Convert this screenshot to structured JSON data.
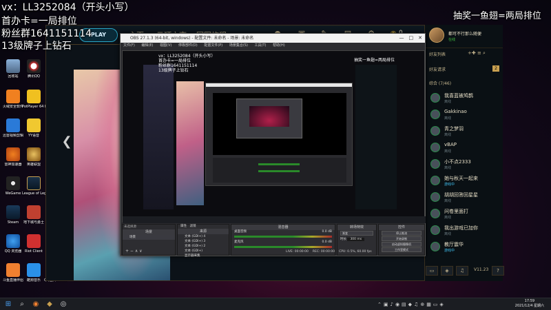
{
  "overlay": {
    "line1": "vx：LL3252084（开头小写）",
    "line2": "首办卡=一局排位",
    "line3": "粉丝群1641151114",
    "line4": "13级牌子上钻石",
    "top_right": "抽奖一鱼翅=两局排位"
  },
  "desktop_icons": [
    "回收站",
    "腾讯QQ",
    "火绒安全软件",
    "PotPlayer 64 bit",
    "迅雷视频剪辑",
    "YY语音",
    "雷神加速器",
    "英雄联盟",
    "WeGame",
    "League of Legends",
    "Steam",
    "地下城与勇士",
    "QQ 浏览器",
    "Riot Client",
    "斗鱼直播伴侣",
    "酷狗音乐",
    "QQ图片20211118..."
  ],
  "lol": {
    "play_label": "PLAY",
    "tabs": [
      "主页",
      "云顶之弈",
      "冠军旅程"
    ],
    "currency": "0",
    "friends_header": "好友列表",
    "friend_requests": "好友请求",
    "friend_requests_count": "2",
    "summoner_name": "都可不行那么随便",
    "summoner_status": "在线",
    "group_label": "综合 (7/46)",
    "friends": [
      {
        "name": "我喜蓝被鸠鹊",
        "status": "离线"
      },
      {
        "name": "Gakkinao",
        "status": "离线"
      },
      {
        "name": "青之梦羽",
        "status": "离线"
      },
      {
        "name": "vBAP",
        "status": "离线"
      },
      {
        "name": "小不点2333",
        "status": "离线"
      },
      {
        "name": "她与秋天一起来",
        "status": "游戏中"
      },
      {
        "name": "胡胡回答回星星",
        "status": "离线"
      },
      {
        "name": "问卷里面打",
        "status": "离线"
      },
      {
        "name": "我出游戏已加你",
        "status": "离线"
      },
      {
        "name": "教厅震华",
        "status": "游戏中"
      }
    ],
    "version": "V11.23"
  },
  "obs": {
    "title": "OBS 27.1.3 (64-bit, windows) - 配置文件: 未命名 - 场景: 未命名",
    "menu": [
      "文件(F)",
      "编辑(E)",
      "视图(V)",
      "停靠部件(D)",
      "配置文件(P)",
      "场景集合(S)",
      "工具(T)",
      "帮助(H)"
    ],
    "no_source": "未选择源",
    "properties": "属性",
    "filters": "滤镜",
    "docks": {
      "scenes": "场景",
      "sources": "来源",
      "mixer": "混音器",
      "transitions": "转场特效",
      "controls": "控件"
    },
    "scene_item": "场景",
    "sources": [
      "文本 (GDI+) 4",
      "文本 (GDI+) 3",
      "文本 (GDI+) 2",
      "文本 (GDI+)",
      "显示器采集"
    ],
    "mixer": [
      {
        "name": "桌面音频",
        "value": "0.0 dB"
      },
      {
        "name": "麦克风",
        "value": "0.0 dB"
      }
    ],
    "transition": "渐变",
    "duration_label": "时长",
    "duration": "300 ms",
    "controls": [
      "停止推流",
      "开始录制",
      "启动虚拟摄像机",
      "工作室模式",
      "设置",
      "退出"
    ],
    "status": {
      "live": "LIVE: 00:00:00",
      "rec": "REC: 00:00:00",
      "cpu": "CPU: 0.5%, 60.00 fps"
    },
    "inner_title": "抽奖一鱼翅=两局排位",
    "inner_overlay": [
      "vx：LL3252084（开头小写）",
      "首办卡=一局排位",
      "粉丝群1641151114",
      "13级牌子上钻石"
    ]
  },
  "taskbar": {
    "time": "17:59",
    "date": "2021/12/4 星期六"
  }
}
